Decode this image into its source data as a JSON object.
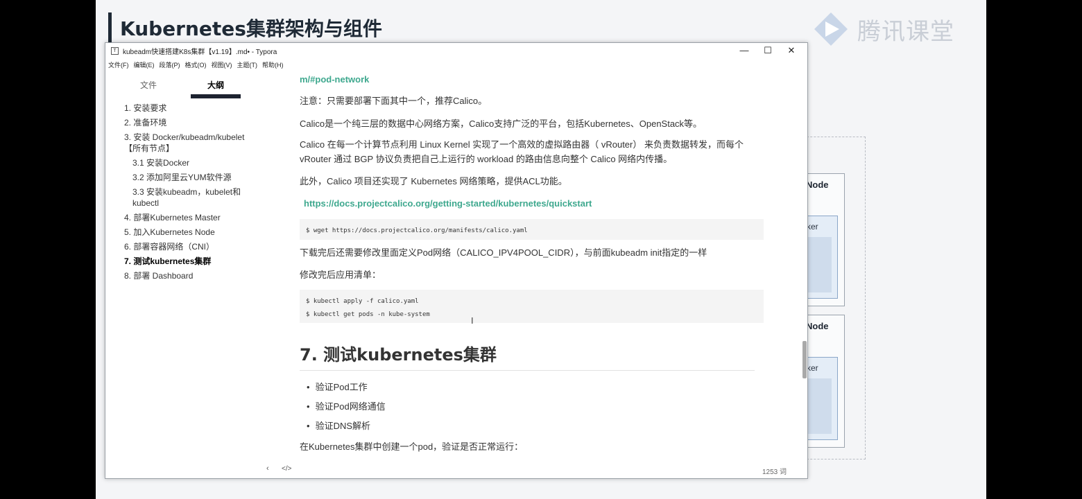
{
  "slide": {
    "title": "Kubernetes集群架构与组件",
    "brand": "腾讯课堂",
    "node_label": "Node",
    "docker_label": "ker"
  },
  "window": {
    "title": "kubeadm快速搭建K8s集群【v1.19】.md• - Typora",
    "controls": [
      "—",
      "☐",
      "✕"
    ],
    "menu": [
      "文件(F)",
      "编辑(E)",
      "段落(P)",
      "格式(O)",
      "视图(V)",
      "主题(T)",
      "帮助(H)"
    ]
  },
  "sidebar": {
    "tabs": [
      "文件",
      "大纲"
    ],
    "active_tab": "大纲",
    "toc": [
      {
        "label": "1. 安装要求",
        "level": 1
      },
      {
        "label": "2. 准备环境",
        "level": 1
      },
      {
        "label": "3. 安装 Docker/kubeadm/kubelet【所有节点】",
        "level": 1
      },
      {
        "label": "3.1 安装Docker",
        "level": 2
      },
      {
        "label": "3.2 添加阿里云YUM软件源",
        "level": 2
      },
      {
        "label": "3.3 安装kubeadm，kubelet和kubectl",
        "level": 2
      },
      {
        "label": "4. 部署Kubernetes Master",
        "level": 1
      },
      {
        "label": "5. 加入Kubernetes Node",
        "level": 1
      },
      {
        "label": "6. 部署容器网络（CNI）",
        "level": 1
      },
      {
        "label": "7. 测试kubernetes集群",
        "level": 1,
        "active": true
      },
      {
        "label": "8. 部署 Dashboard",
        "level": 1
      }
    ]
  },
  "content": {
    "link_top": "m/#pod-network",
    "note": "注意：只需要部署下面其中一个，推荐Calico。",
    "calico_intro": "Calico是一个纯三层的数据中心网络方案，Calico支持广泛的平台，包括Kubernetes、OpenStack等。",
    "calico_detail_1": "Calico 在每一个计算节点利用 Linux Kernel 实现了一个高效的虚拟路由器（ vRouter） 来负责数据转发，而每个",
    "calico_detail_2": "vRouter 通过 BGP 协议负责把自己上运行的 workload 的路由信息向整个 Calico 网络内传播。",
    "calico_policy": "此外，Calico  项目还实现了 Kubernetes 网络策略，提供ACL功能。",
    "link_quickstart": "https://docs.projectcalico.org/getting-started/kubernetes/quickstart",
    "code_wget": "$ wget https://docs.projectcalico.org/manifests/calico.yaml",
    "modify_note": "下载完后还需要修改里面定义Pod网络（CALICO_IPV4POOL_CIDR），与前面kubeadm init指定的一样",
    "apply_note": "修改完后应用清单：",
    "code_apply_1": "$ kubectl apply -f calico.yaml",
    "code_apply_2": "$ kubectl get pods -n kube-system",
    "heading_7": "7. 测试kubernetes集群",
    "bullets": [
      "验证Pod工作",
      "验证Pod网络通信",
      "验证DNS解析"
    ],
    "create_pod": "在Kubernetes集群中创建一个pod，验证是否正常运行："
  },
  "status": {
    "back": "‹",
    "source": "</>",
    "word_count": "1253 词"
  }
}
